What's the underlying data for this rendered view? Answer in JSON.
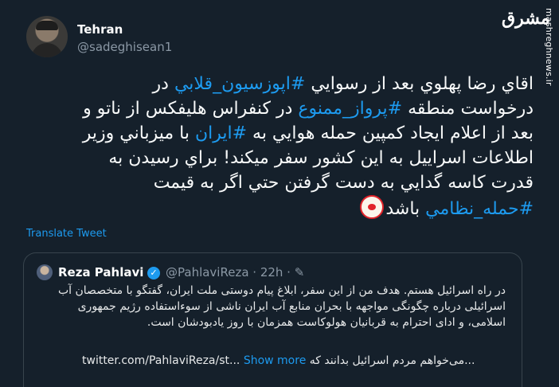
{
  "author": {
    "name": "Tehran",
    "handle": "@sadeghisean1"
  },
  "brand": {
    "logo_text": "مشرق",
    "watermark": "mashreghnews.ir"
  },
  "tweet": {
    "line1_a": "اقاي رضا پهلوي بعد از رسوايي ",
    "line1_tag": "#اپوزسیون_قلابي",
    "line1_b": " در",
    "line2_a": "درخواست منطقه ",
    "line2_tag": "#پرواز_ممنوع",
    "line2_b": " در كنفراس هليفكس از ناتو و",
    "line3_a": "بعد از اعلام ايجاد كمپين حمله هوايي به ",
    "line3_tag": "#ايران",
    "line3_b": " با ميزباني وزير",
    "line4": "اطلاعات اسراييل به اين كشور سفر ميكند! براي رسيدن به",
    "line5": "قدرت كاسه گدايي به دست گرفتن حتي اگر به قيمت",
    "line6_tag": "#حمله_نظامي",
    "line6_b": " باشد"
  },
  "translate_label": "Translate Tweet",
  "quote": {
    "name": "Reza Pahlavi",
    "verified": "✓",
    "meta": "@PahlaviReza · 22h · ✎",
    "text": "در راه اسرائیل هستم. هدف من از این سفر، ابلاغ پیام دوستی ملت ایران، گفتگو با متخصصان آب اسرائیلی درباره چگونگی مواجهه با بحران منابع آب ایران ناشی از سوءاستفاده رژیم جمهوری اسلامی، و ادای احترام به قربانیان هولوکاست همزمان با روز یادبودشان است.",
    "link": "twitter.com/PahlaviReza/st...",
    "show_more": "Show more",
    "last_line": "می‌خواهم مردم اسرائیل بدانند که..."
  }
}
